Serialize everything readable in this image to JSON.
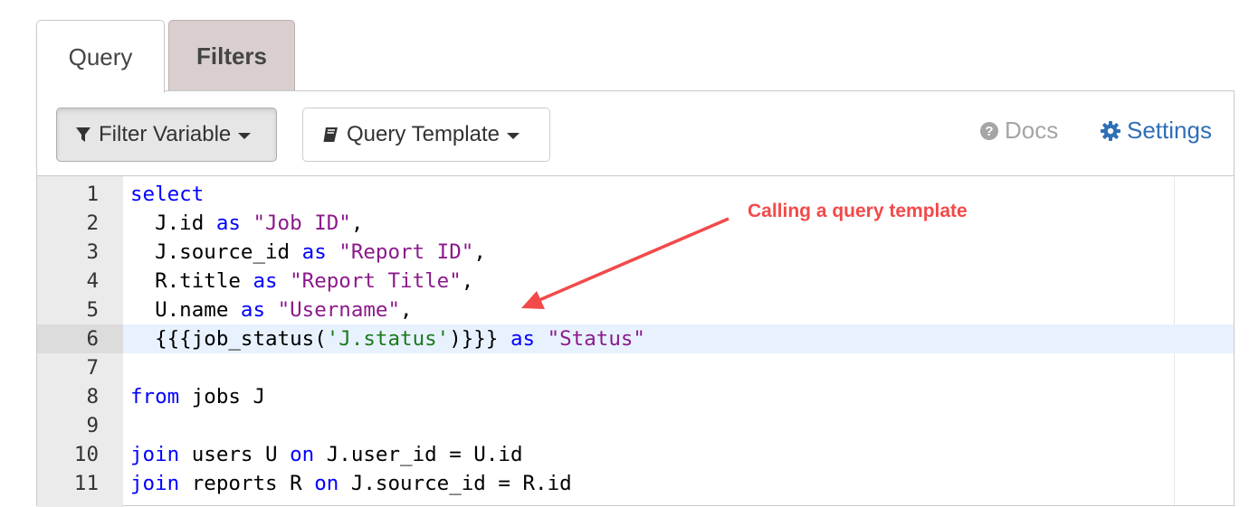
{
  "tabs": [
    {
      "label": "Query",
      "active": true
    },
    {
      "label": "Filters",
      "active": false
    }
  ],
  "toolbar": {
    "filter_variable_label": "Filter Variable",
    "query_template_label": "Query Template",
    "docs_label": "Docs",
    "settings_label": "Settings"
  },
  "editor": {
    "active_line": 6,
    "line_numbers": [
      "1",
      "2",
      "3",
      "4",
      "5",
      "6",
      "7",
      "8",
      "9",
      "10",
      "11"
    ]
  },
  "annotation": {
    "text": "Calling a query template"
  },
  "colors": {
    "accent": "#2f6fb5",
    "annotation": "#f24a4a",
    "keyword": "#0000ff",
    "string": "#8b1a8b",
    "template_string": "#1a7a1a",
    "active_line_bg": "#e8f2fe"
  }
}
